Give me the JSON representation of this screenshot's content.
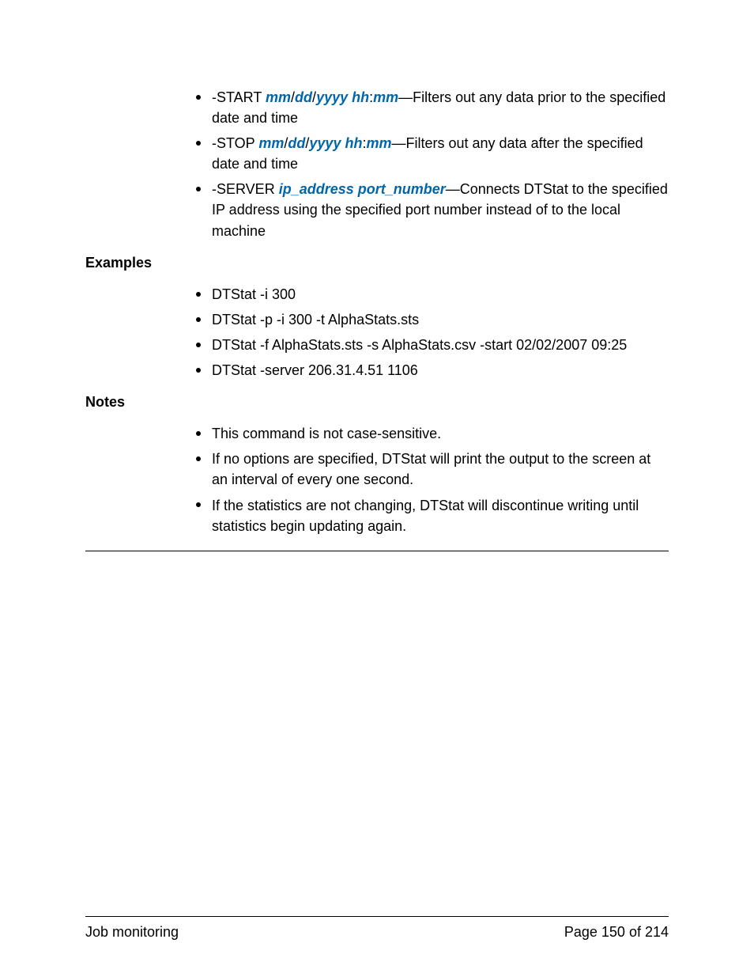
{
  "options": [
    {
      "prefix": "-START ",
      "params": [
        {
          "t": "kw",
          "v": "mm"
        },
        {
          "t": "txt",
          "v": "/"
        },
        {
          "t": "kw",
          "v": "dd"
        },
        {
          "t": "txt",
          "v": "/"
        },
        {
          "t": "kw",
          "v": "yyyy hh"
        },
        {
          "t": "txt",
          "v": ":"
        },
        {
          "t": "kw",
          "v": "mm"
        }
      ],
      "desc": "—Filters out any data prior to the specified date and time"
    },
    {
      "prefix": "-STOP ",
      "params": [
        {
          "t": "kw",
          "v": "mm"
        },
        {
          "t": "txt",
          "v": "/"
        },
        {
          "t": "kw",
          "v": "dd"
        },
        {
          "t": "txt",
          "v": "/"
        },
        {
          "t": "kw",
          "v": "yyyy hh"
        },
        {
          "t": "txt",
          "v": ":"
        },
        {
          "t": "kw",
          "v": "mm"
        }
      ],
      "desc": "—Filters out any data after the specified date and time"
    },
    {
      "prefix": "-SERVER ",
      "params": [
        {
          "t": "kw",
          "v": "ip_address port_number"
        }
      ],
      "desc": "—Connects DTStat to the specified IP address using the specified port number instead of to the local machine"
    }
  ],
  "labels": {
    "examples": "Examples",
    "notes": "Notes"
  },
  "examples": [
    "DTStat -i 300",
    "DTStat -p -i 300 -t AlphaStats.sts",
    "DTStat -f AlphaStats.sts -s AlphaStats.csv -start 02/02/2007 09:25",
    "DTStat -server 206.31.4.51 1106"
  ],
  "notes": [
    "This command is not case-sensitive.",
    "If no options are specified, DTStat will print the output to the screen at an interval of every one second.",
    "If the statistics are not changing, DTStat will discontinue writing until statistics begin updating again."
  ],
  "footer": {
    "left": "Job monitoring",
    "right": "Page 150 of 214"
  }
}
